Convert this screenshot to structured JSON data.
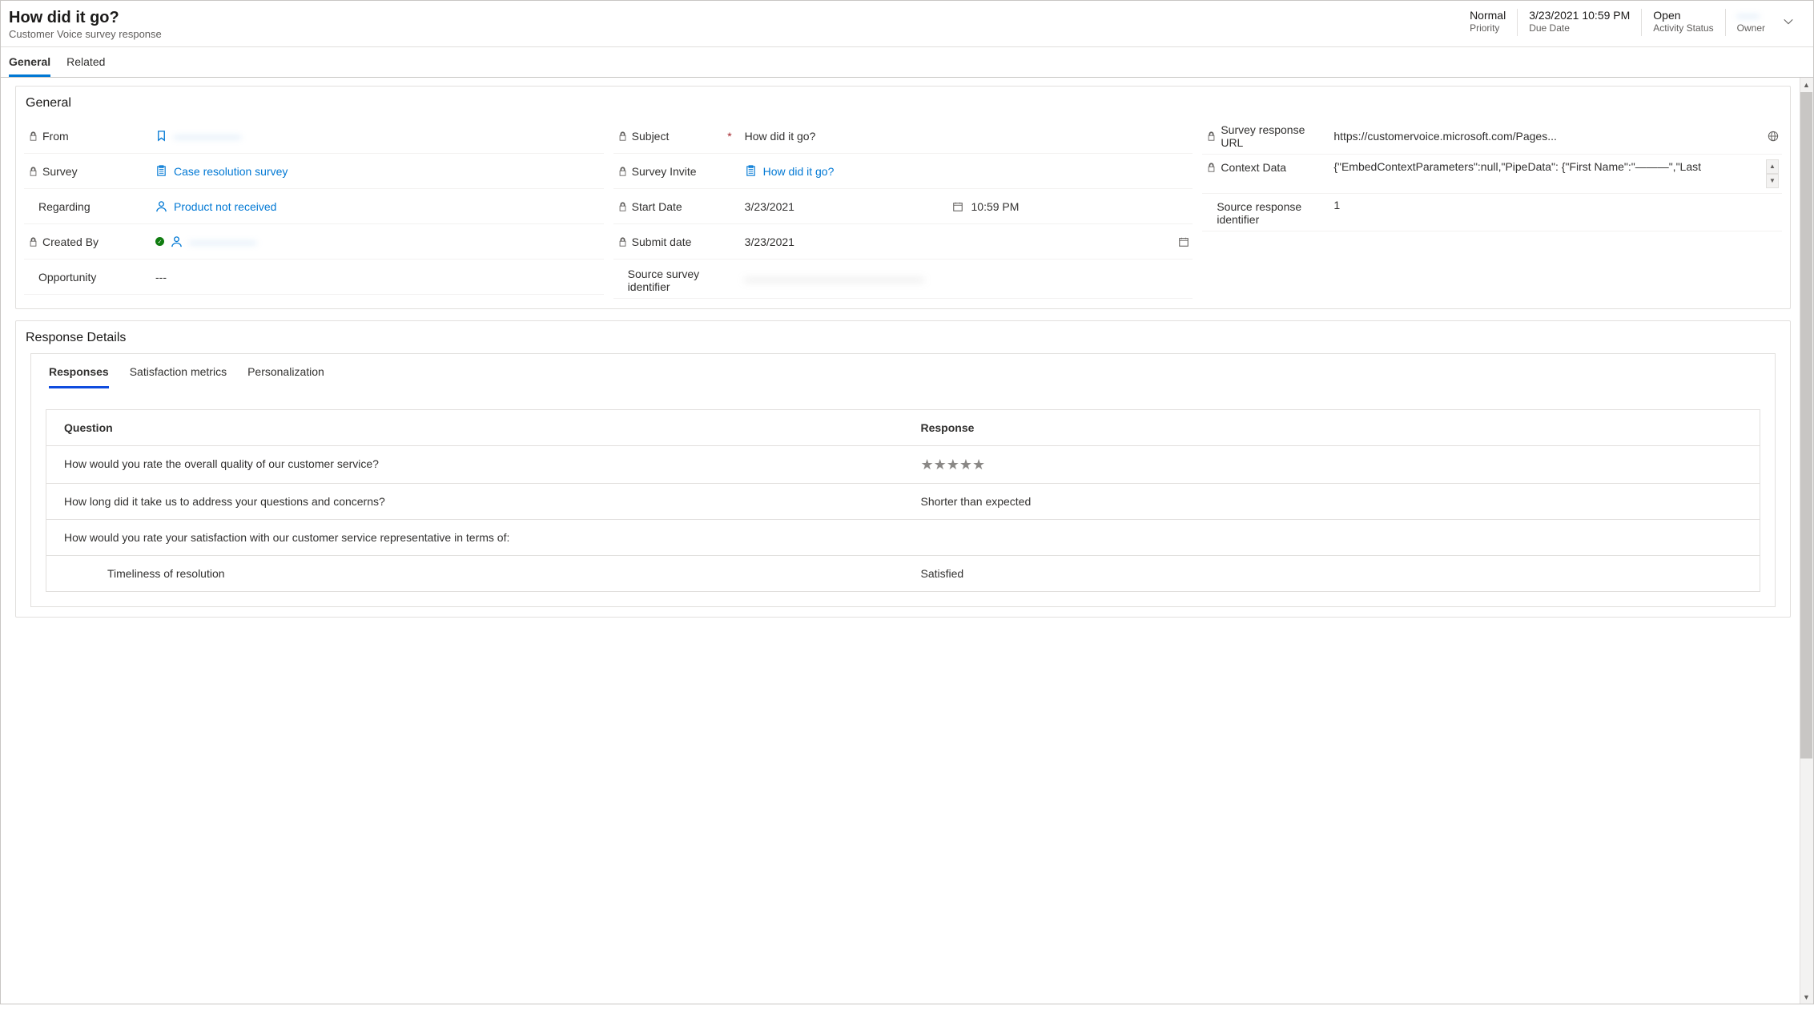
{
  "header": {
    "title": "How did it go?",
    "subtitle": "Customer Voice survey response",
    "status_cells": [
      {
        "value": "Normal",
        "label": "Priority"
      },
      {
        "value": "3/23/2021 10:59 PM",
        "label": "Due Date"
      },
      {
        "value": "Open",
        "label": "Activity Status"
      },
      {
        "value": "——",
        "label": "Owner",
        "blurred": true
      }
    ]
  },
  "tabs": {
    "general": "General",
    "related": "Related"
  },
  "section_general": {
    "title": "General",
    "col1": {
      "from_label": "From",
      "from_value": "——————",
      "survey_label": "Survey",
      "survey_value": "Case resolution survey",
      "regarding_label": "Regarding",
      "regarding_value": "Product not received",
      "createdby_label": "Created By",
      "createdby_value": "——————",
      "opportunity_label": "Opportunity",
      "opportunity_value": "---"
    },
    "col2": {
      "subject_label": "Subject",
      "subject_value": "How did it go?",
      "invite_label": "Survey Invite",
      "invite_value": "How did it go?",
      "start_label": "Start Date",
      "start_date": "3/23/2021",
      "start_time": "10:59 PM",
      "submit_label": "Submit date",
      "submit_date": "3/23/2021",
      "src_survey_label": "Source survey identifier",
      "src_survey_value": "————————————————"
    },
    "col3": {
      "url_label": "Survey response URL",
      "url_value": "https://customervoice.microsoft.com/Pages...",
      "ctx_label": "Context Data",
      "ctx_value": "{\"EmbedContextParameters\":null,\"PipeData\": {\"First Name\":\"———\",\"Last",
      "src_resp_label": "Source response identifier",
      "src_resp_value": "1"
    }
  },
  "section_details": {
    "title": "Response Details",
    "tabs": {
      "responses": "Responses",
      "satisfaction": "Satisfaction metrics",
      "personalization": "Personalization"
    },
    "table": {
      "head_q": "Question",
      "head_r": "Response",
      "rows": [
        {
          "q": "How would you rate the overall quality of our customer service?",
          "r": "★★★★★",
          "stars": true
        },
        {
          "q": "How long did it take us to address your questions and concerns?",
          "r": "Shorter than expected"
        },
        {
          "q": "How would you rate your satisfaction with our customer service representative in terms of:",
          "r": ""
        },
        {
          "q": "Timeliness of resolution",
          "r": "Satisfied",
          "indent": true
        }
      ]
    }
  }
}
